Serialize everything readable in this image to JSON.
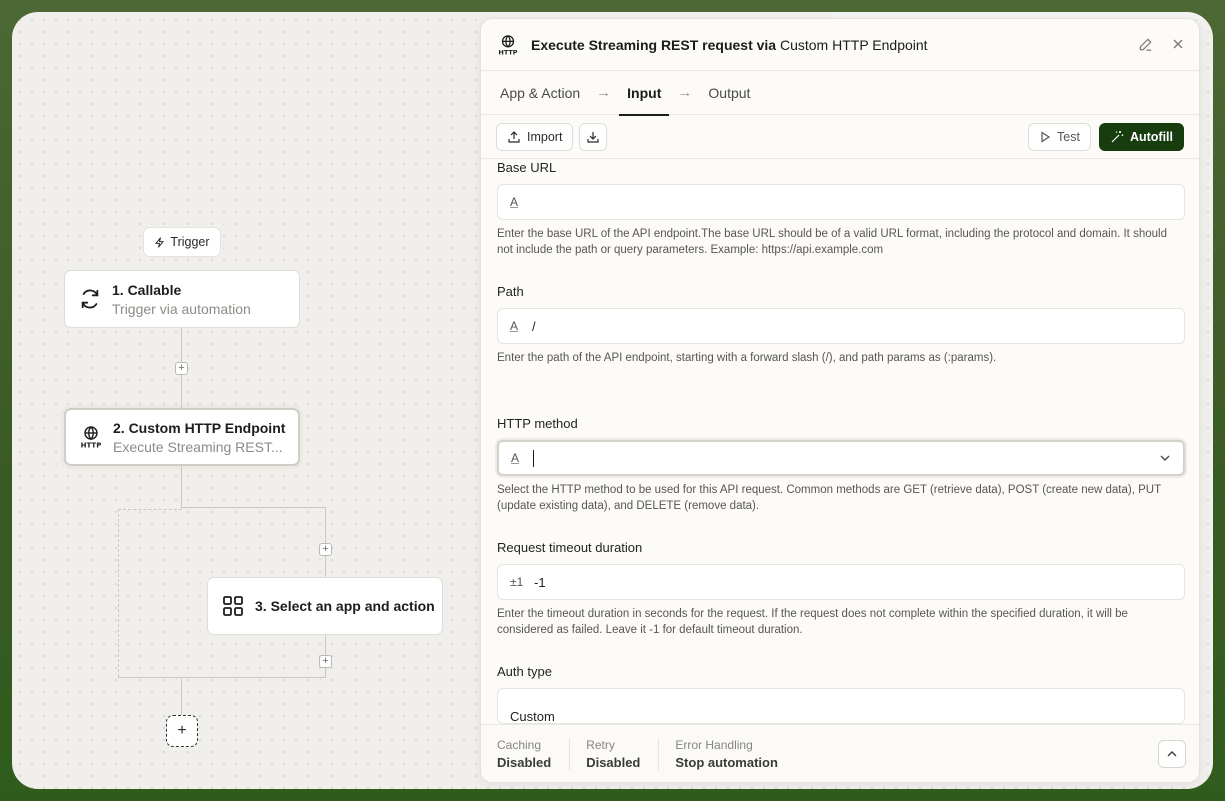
{
  "canvas": {
    "trigger_pill": "Trigger",
    "nodes": [
      {
        "title": "1. Callable",
        "subtitle": "Trigger via automation",
        "icon": "refresh-icon"
      },
      {
        "title": "2. Custom HTTP Endpoint",
        "subtitle": "Execute Streaming REST...",
        "icon": "http-globe-icon"
      },
      {
        "title": "3. Select an app and action",
        "subtitle": "",
        "icon": "grid-icon"
      }
    ],
    "add_symbol": "+"
  },
  "panel": {
    "title_bold": "Execute Streaming REST request via",
    "title_rest": "Custom HTTP Endpoint",
    "tabs": [
      {
        "label": "App & Action"
      },
      {
        "label": "Input"
      },
      {
        "label": "Output"
      }
    ],
    "tab_arrow": "→",
    "toolbar": {
      "import_label": "Import",
      "test_label": "Test",
      "autofill_label": "Autofill"
    },
    "fields": [
      {
        "label": "Base URL",
        "prefix": "A",
        "value": "",
        "help": "Enter the base URL of the API endpoint.The base URL should be of a valid URL format, including the protocol and domain. It should not include the path or query parameters. Example: https://api.example.com"
      },
      {
        "label": "Path",
        "prefix": "A",
        "value": "/",
        "help": "Enter the path of the API endpoint, starting with a forward slash (/), and path params as (:params)."
      },
      {
        "label": "HTTP method",
        "prefix": "A",
        "value": "",
        "help": "Select the HTTP method to be used for this API request. Common methods are GET (retrieve data), POST (create new data), PUT (update existing data), and DELETE (remove data)."
      },
      {
        "label": "Request timeout duration",
        "prefix": "±1",
        "value": "-1",
        "help": "Enter the timeout duration in seconds for the request. If the request does not complete within the specified duration, it will be considered as failed. Leave it -1 for default timeout duration."
      },
      {
        "label": "Auth type",
        "prefix": "",
        "value": "Custom",
        "help": ""
      }
    ],
    "footer": [
      {
        "key": "Caching",
        "value": "Disabled"
      },
      {
        "key": "Retry",
        "value": "Disabled"
      },
      {
        "key": "Error Handling",
        "value": "Stop automation"
      }
    ]
  },
  "colors": {
    "accent_dark": "#173d0f",
    "frame_green": "#3e5a2a"
  }
}
